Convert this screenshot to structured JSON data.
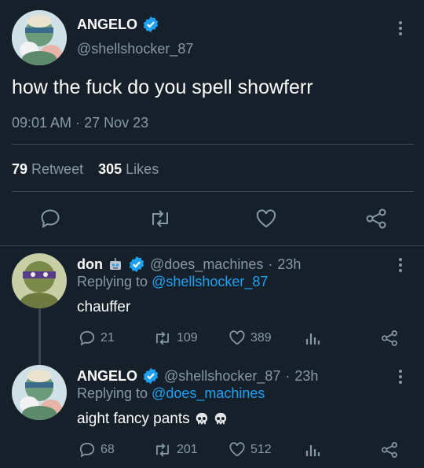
{
  "main_tweet": {
    "display_name": "ANGELO",
    "handle": "@shellshocker_87",
    "text": "how the fuck do you spell showferr",
    "time": "09:01 AM",
    "sep": "·",
    "date": "27 Nov 23",
    "retweet_count": "79",
    "retweet_label": "Retweet",
    "likes_count": "305",
    "likes_label": "Likes"
  },
  "replies": [
    {
      "display_name": "don",
      "handle": "@does_machines",
      "sep": "·",
      "time": "23h",
      "replying_prefix": "Replying to",
      "replying_to": "@shellshocker_87",
      "text": "chauffer",
      "replies": "21",
      "retweets": "109",
      "likes": "389"
    },
    {
      "display_name": "ANGELO",
      "handle": "@shellshocker_87",
      "sep": "·",
      "time": "23h",
      "replying_prefix": "Replying to",
      "replying_to": "@does_machines",
      "text": "aight fancy pants",
      "replies": "68",
      "retweets": "201",
      "likes": "512"
    }
  ],
  "colors": {
    "background": "#15202b",
    "muted": "#8899a6",
    "link": "#1da1f2",
    "divider": "#38444d"
  }
}
